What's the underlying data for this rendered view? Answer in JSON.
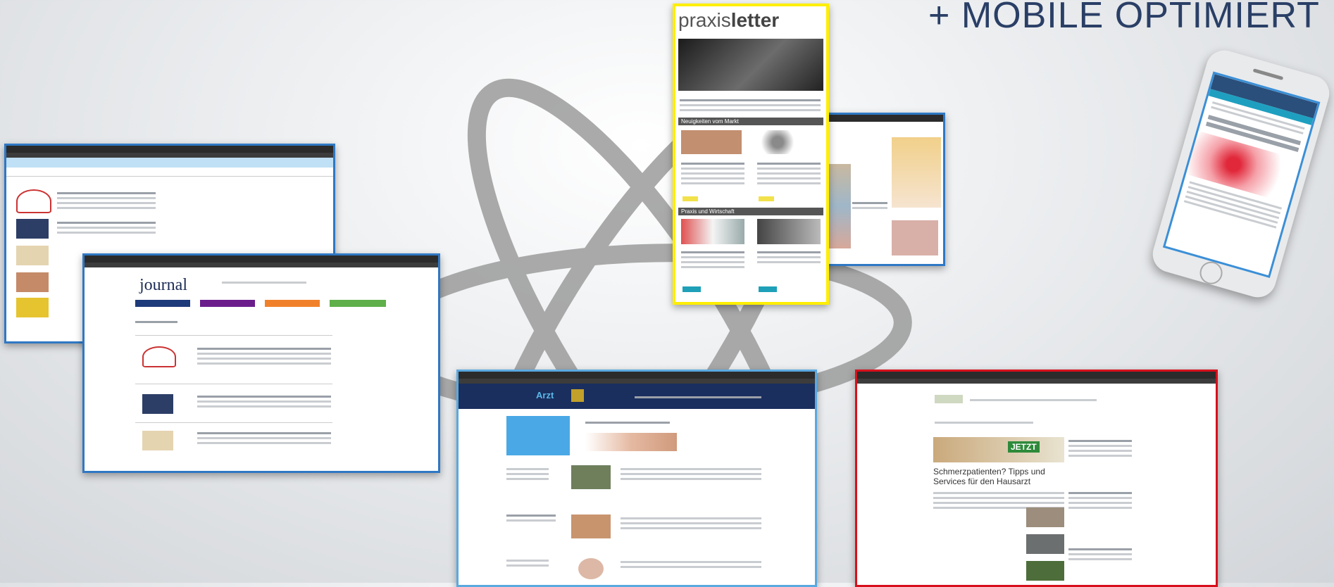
{
  "headline": "+ MOBILE OPTIMIERT",
  "praxisletter": {
    "brand_light": "praxis",
    "brand_bold": "letter",
    "section_1": "Neuigkeiten vom Markt",
    "section_2": "Praxis und Wirtschaft"
  },
  "journal": {
    "logo": "journal"
  },
  "arzt_portal": {
    "logo": "Arzt"
  },
  "red_portal": {
    "badge": "JETZT",
    "headline": "Schmerzpatienten? Tipps und Services für den Hausarzt"
  },
  "colors": {
    "praxisletter_frame": "#ffee00",
    "blue_frame": "#2f78c4",
    "red_frame": "#d6101c",
    "phone_frame": "#3b8fd6",
    "headline": "#2a3f66"
  }
}
